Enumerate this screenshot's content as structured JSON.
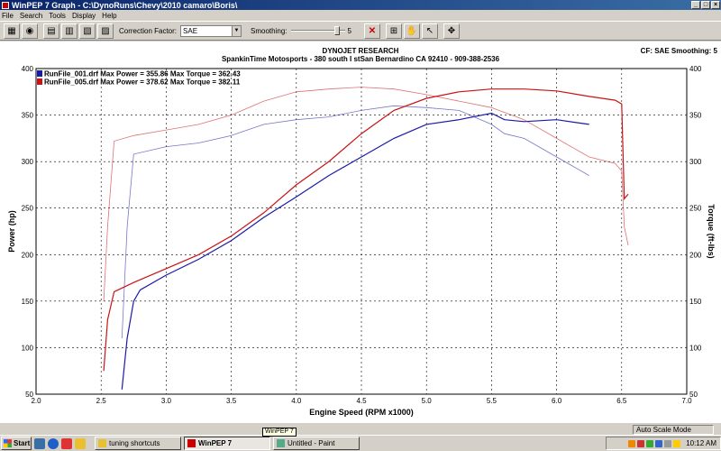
{
  "window": {
    "title": "WinPEP 7    Graph - C:\\DynoRuns\\Chevy\\2010 camaro\\Boris\\"
  },
  "menu": [
    "File",
    "Search",
    "Tools",
    "Display",
    "Help"
  ],
  "toolbar": {
    "correction_label": "Correction Factor:",
    "correction_value": "SAE",
    "smoothing_label": "Smoothing:",
    "smoothing_value": "5"
  },
  "graph_header": {
    "company": "DYNOJET RESEARCH",
    "location": "SpankinTime Motosports - 380 south I stSan Bernardino CA 92410 - 909-388-2536",
    "settings": "CF: SAE  Smoothing: 5"
  },
  "legend": [
    {
      "text": "RunFile_001.drf Max Power = 355.86 Max Torque = 362.43",
      "color": "#1a1aa8"
    },
    {
      "text": "RunFile_005.drf Max Power = 378.62 Max Torque = 382.11",
      "color": "#c81414"
    }
  ],
  "chart_data": {
    "type": "line",
    "xlabel": "Engine Speed (RPM x1000)",
    "ylabel": "Power (hp)",
    "y2label": "Torque (ft-lbs)",
    "xlim": [
      2.0,
      7.0
    ],
    "ylim": [
      50,
      400
    ],
    "y2lim": [
      50,
      400
    ],
    "xticks": [
      "2.0",
      "2.5",
      "3.0",
      "3.5",
      "4.0",
      "4.5",
      "5.0",
      "5.5",
      "6.0",
      "6.5",
      "7.0"
    ],
    "yticks": [
      "50",
      "100",
      "150",
      "200",
      "250",
      "300",
      "350",
      "400"
    ],
    "grid": true,
    "series": [
      {
        "name": "RunFile_001.drf",
        "quantity": "power",
        "color": "#1a1aa8",
        "x": [
          2.66,
          2.7,
          2.75,
          2.8,
          3.0,
          3.25,
          3.5,
          3.75,
          4.0,
          4.25,
          4.5,
          4.75,
          5.0,
          5.25,
          5.5,
          5.6,
          5.75,
          6.0,
          6.25
        ],
        "y": [
          55,
          110,
          150,
          162,
          178,
          195,
          215,
          240,
          262,
          285,
          305,
          325,
          340,
          345,
          352,
          345,
          343,
          345,
          340
        ]
      },
      {
        "name": "RunFile_001.drf",
        "quantity": "torque",
        "color": "#1a1aa8",
        "x": [
          2.66,
          2.7,
          2.75,
          3.0,
          3.25,
          3.5,
          3.75,
          4.0,
          4.25,
          4.5,
          4.75,
          5.0,
          5.25,
          5.5,
          5.6,
          5.75,
          6.0,
          6.25
        ],
        "y": [
          110,
          230,
          308,
          316,
          320,
          328,
          340,
          345,
          348,
          355,
          360,
          358,
          355,
          340,
          330,
          325,
          305,
          285
        ]
      },
      {
        "name": "RunFile_005.drf",
        "quantity": "power",
        "color": "#c81414",
        "x": [
          2.52,
          2.55,
          2.6,
          2.75,
          3.0,
          3.25,
          3.5,
          3.75,
          4.0,
          4.25,
          4.5,
          4.75,
          5.0,
          5.25,
          5.5,
          5.75,
          6.0,
          6.25,
          6.45,
          6.5,
          6.52,
          6.55
        ],
        "y": [
          75,
          130,
          160,
          170,
          185,
          200,
          220,
          245,
          275,
          300,
          330,
          355,
          368,
          375,
          378,
          378,
          376,
          370,
          366,
          362,
          260,
          265
        ]
      },
      {
        "name": "RunFile_005.drf",
        "quantity": "torque",
        "color": "#c81414",
        "x": [
          2.52,
          2.55,
          2.6,
          2.75,
          3.0,
          3.25,
          3.5,
          3.75,
          4.0,
          4.25,
          4.5,
          4.75,
          5.0,
          5.25,
          5.5,
          5.75,
          6.0,
          6.25,
          6.45,
          6.5,
          6.52,
          6.55
        ],
        "y": [
          150,
          230,
          322,
          328,
          334,
          340,
          350,
          365,
          375,
          378,
          380,
          378,
          372,
          365,
          358,
          345,
          325,
          305,
          298,
          290,
          230,
          210
        ]
      }
    ]
  },
  "status": {
    "scale_mode": "Auto Scale Mode"
  },
  "taskbar": {
    "start": "Start",
    "tasks": [
      {
        "label": "tuning shortcuts",
        "active": false
      },
      {
        "label": "WinPEP 7",
        "active": true
      },
      {
        "label": "Untitled - Paint",
        "active": false
      }
    ],
    "tooltip": "WinPEP 7",
    "clock": "10:12 AM"
  }
}
